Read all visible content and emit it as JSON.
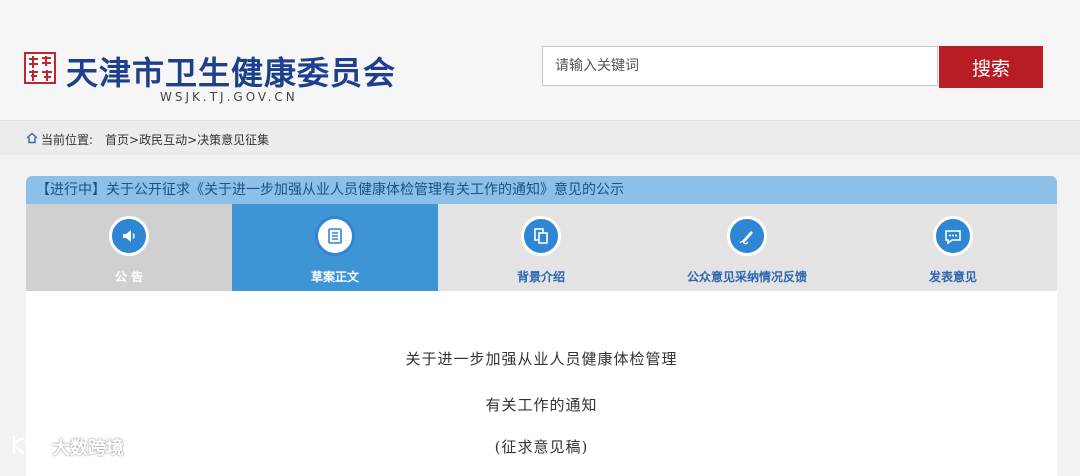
{
  "header": {
    "site_title": "天津市卫生健康委员会",
    "site_domain": "WSJK.TJ.GOV.CN",
    "search_placeholder": "请输入关键词",
    "search_button": "搜索"
  },
  "breadcrumb": {
    "label": "当前位置:",
    "items": [
      "首页",
      "政民互动",
      "决策意见征集"
    ],
    "separator": ">"
  },
  "card": {
    "title": "【进行中】关于公开征求《关于进一步加强从业人员健康体检管理有关工作的通知》意见的公示",
    "tabs": [
      {
        "label": "公 告",
        "icon": "speaker-icon"
      },
      {
        "label": "草案正文",
        "icon": "document-icon"
      },
      {
        "label": "背景介绍",
        "icon": "copy-icon"
      },
      {
        "label": "公众意见采纳情况反馈",
        "icon": "pen-icon"
      },
      {
        "label": "发表意见",
        "icon": "chat-icon"
      }
    ],
    "active_tab": 1
  },
  "document": {
    "line1": "关于进一步加强从业人员健康体检管理",
    "line2": "有关工作的通知",
    "line3": "(征求意见稿)"
  },
  "watermark": "大数跨境",
  "colors": {
    "title_blue": "#1d3f8c",
    "search_red": "#b81c25",
    "tab_active": "#3e95d6",
    "icon_blue": "#2f86d2",
    "title_bar": "#8cc0e8"
  }
}
